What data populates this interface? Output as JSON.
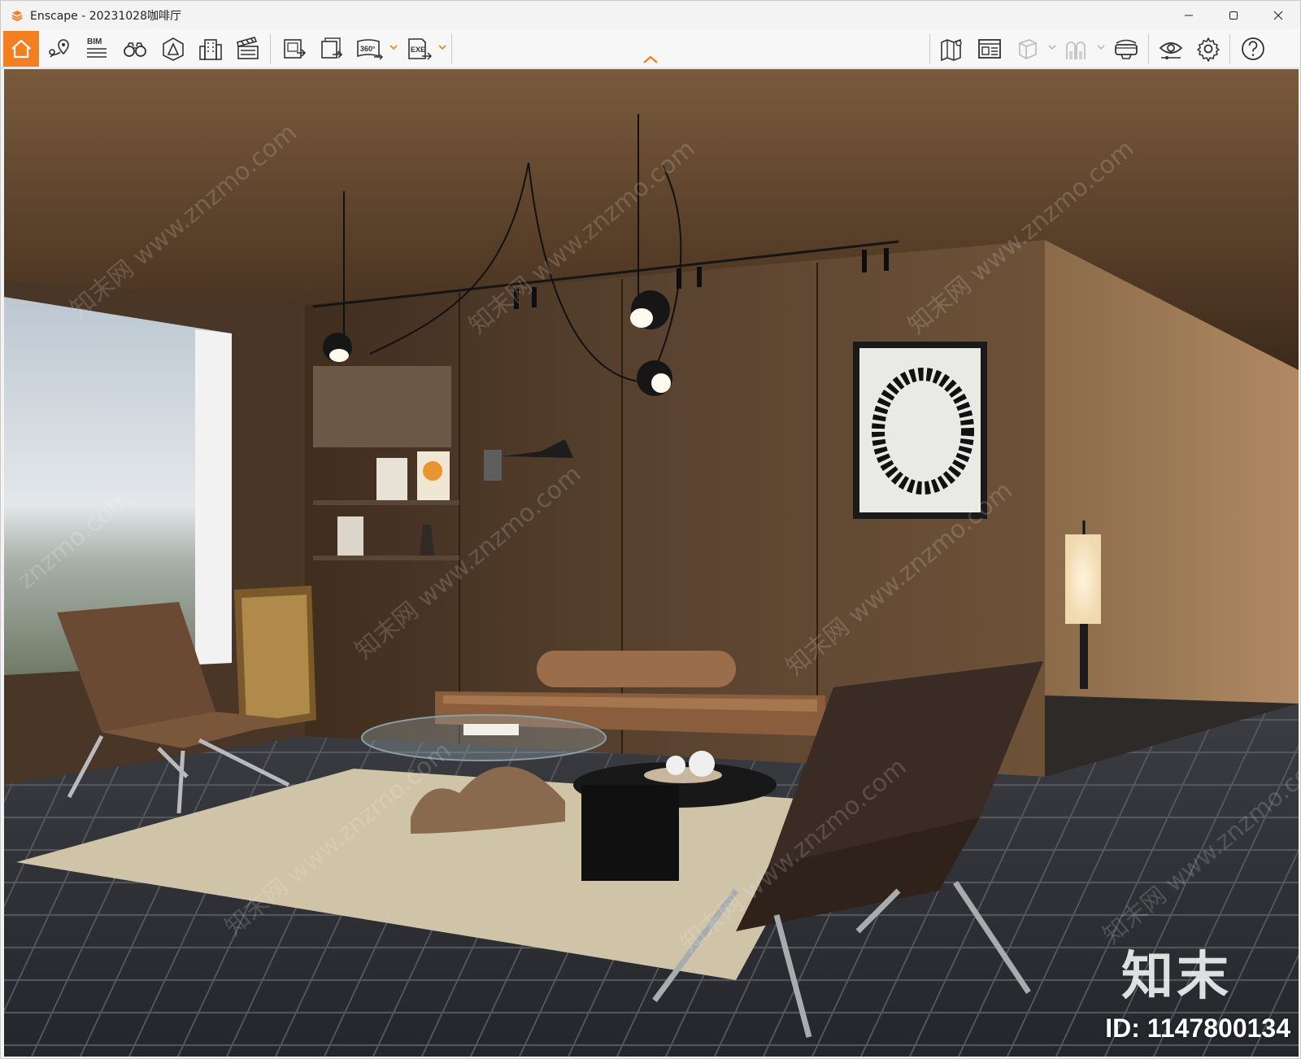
{
  "window": {
    "title": "Enscape - 20231028咖啡厅",
    "controls": [
      "minimize-icon",
      "maximize-icon",
      "close-icon"
    ]
  },
  "toolbar": {
    "left_tools": [
      {
        "name": "home",
        "icon": "home-icon",
        "active": true
      },
      {
        "name": "views",
        "icon": "map-pin-icon"
      },
      {
        "name": "bim",
        "icon": "bim-icon",
        "label": "BIM"
      },
      {
        "name": "walk",
        "icon": "binoculars-icon"
      },
      {
        "name": "assets",
        "icon": "asset-library-icon"
      },
      {
        "name": "buildings",
        "icon": "building-icon"
      },
      {
        "name": "video",
        "icon": "clapperboard-icon"
      }
    ],
    "export_tools": [
      {
        "name": "screenshot-export",
        "icon": "image-export-icon"
      },
      {
        "name": "batch-export",
        "icon": "batch-export-icon"
      },
      {
        "name": "panorama-export",
        "icon": "panorama-icon",
        "label": "360°",
        "has_dropdown": true
      },
      {
        "name": "exe-export",
        "icon": "exe-export-icon",
        "label": "EXE",
        "has_dropdown": true
      }
    ],
    "right_tools": [
      {
        "name": "map",
        "icon": "map-icon"
      },
      {
        "name": "collaboration",
        "icon": "monitor-panel-icon"
      },
      {
        "name": "orthographic",
        "icon": "cube-icon",
        "has_dropdown": true,
        "disabled": true
      },
      {
        "name": "people",
        "icon": "people-icon",
        "has_dropdown": true,
        "disabled": true
      },
      {
        "name": "vr",
        "icon": "vr-headset-icon"
      },
      {
        "name": "visual-settings",
        "icon": "eye-icon"
      },
      {
        "name": "settings",
        "icon": "gear-icon"
      },
      {
        "name": "help",
        "icon": "help-icon"
      }
    ]
  },
  "viewport": {
    "scene": "interior render with wood paneling, window, leather lounge chairs, daybed, glass coffee table, pendant lights",
    "watermark_texts": [
      "知末网 www.znzmo.com",
      "znzmo.com"
    ],
    "brand_mark": "知末",
    "id_label": "ID: 1147800134"
  },
  "colors": {
    "accent": "#f47f20",
    "toolbar_bg": "#f7f7f7",
    "title_bg": "#f3f3f3"
  }
}
